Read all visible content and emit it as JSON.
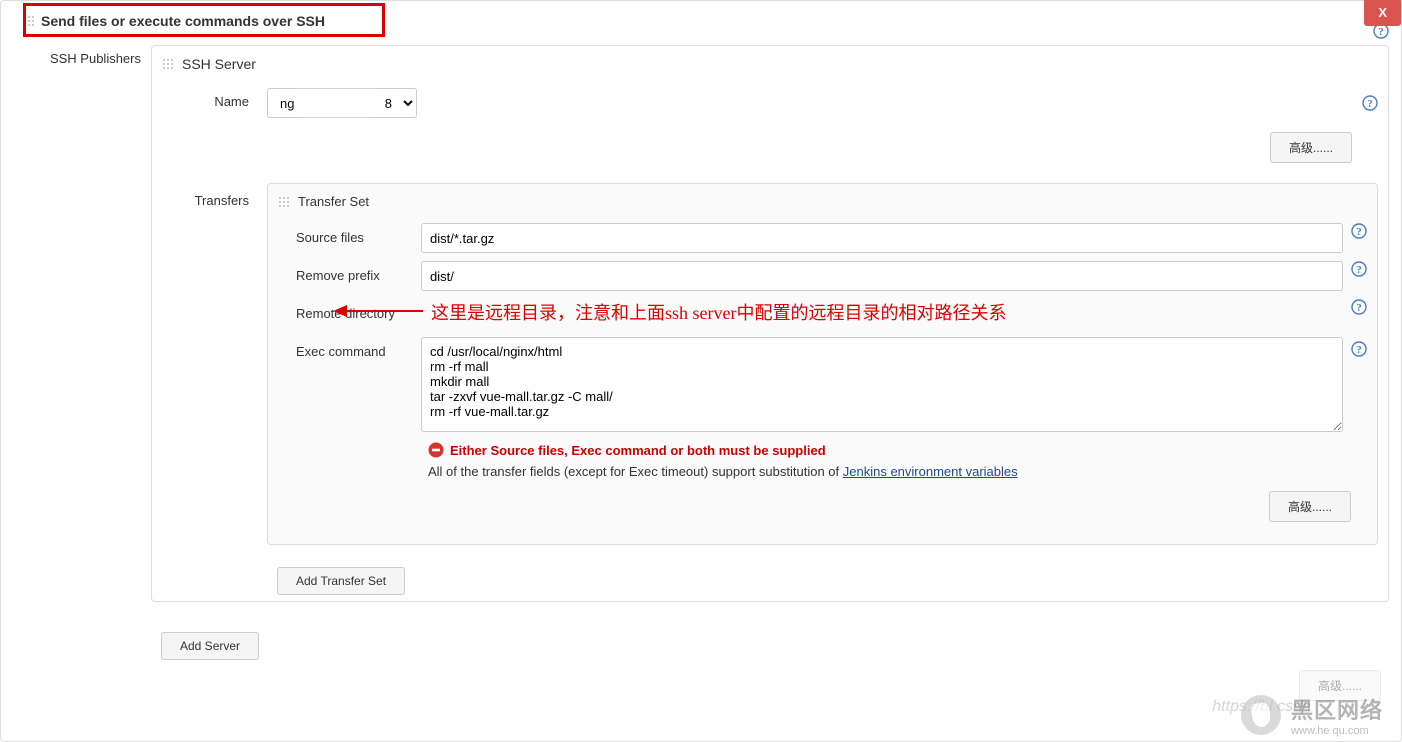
{
  "header": {
    "title": "Send files or execute commands over SSH",
    "close_label": "X"
  },
  "sidebar": {
    "ssh_publishers_label": "SSH Publishers"
  },
  "ssh_server": {
    "block_title": "SSH Server",
    "name_label": "Name",
    "name_value_prefix": "ng",
    "name_value_suffix": "8",
    "advanced_label": "高级......"
  },
  "transfers": {
    "label": "Transfers",
    "block_title": "Transfer Set",
    "source_files_label": "Source files",
    "source_files_value": "dist/*.tar.gz",
    "remove_prefix_label": "Remove prefix",
    "remove_prefix_value": "dist/",
    "remote_directory_label": "Remote directory",
    "remote_directory_annotation": "这里是远程目录，注意和上面ssh server中配置的远程目录的相对路径关系",
    "exec_command_label": "Exec command",
    "exec_command_value": "cd /usr/local/nginx/html\nrm -rf mall\nmkdir mall\ntar -zxvf vue-mall.tar.gz -C mall/\nrm -rf vue-mall.tar.gz",
    "validation_error": "Either Source files, Exec command or both must be supplied",
    "info_text_prefix": "All of the transfer fields (except for Exec timeout) support substitution of ",
    "info_link_text": "Jenkins environment variables",
    "advanced_label": "高级......",
    "add_transfer_set_label": "Add Transfer Set"
  },
  "footer": {
    "add_server_label": "Add Server",
    "advanced_label": "高级......"
  },
  "watermark": {
    "cn": "黑区网络",
    "en": "www.he   qu.com",
    "csdn": "https://bl   csdn"
  }
}
